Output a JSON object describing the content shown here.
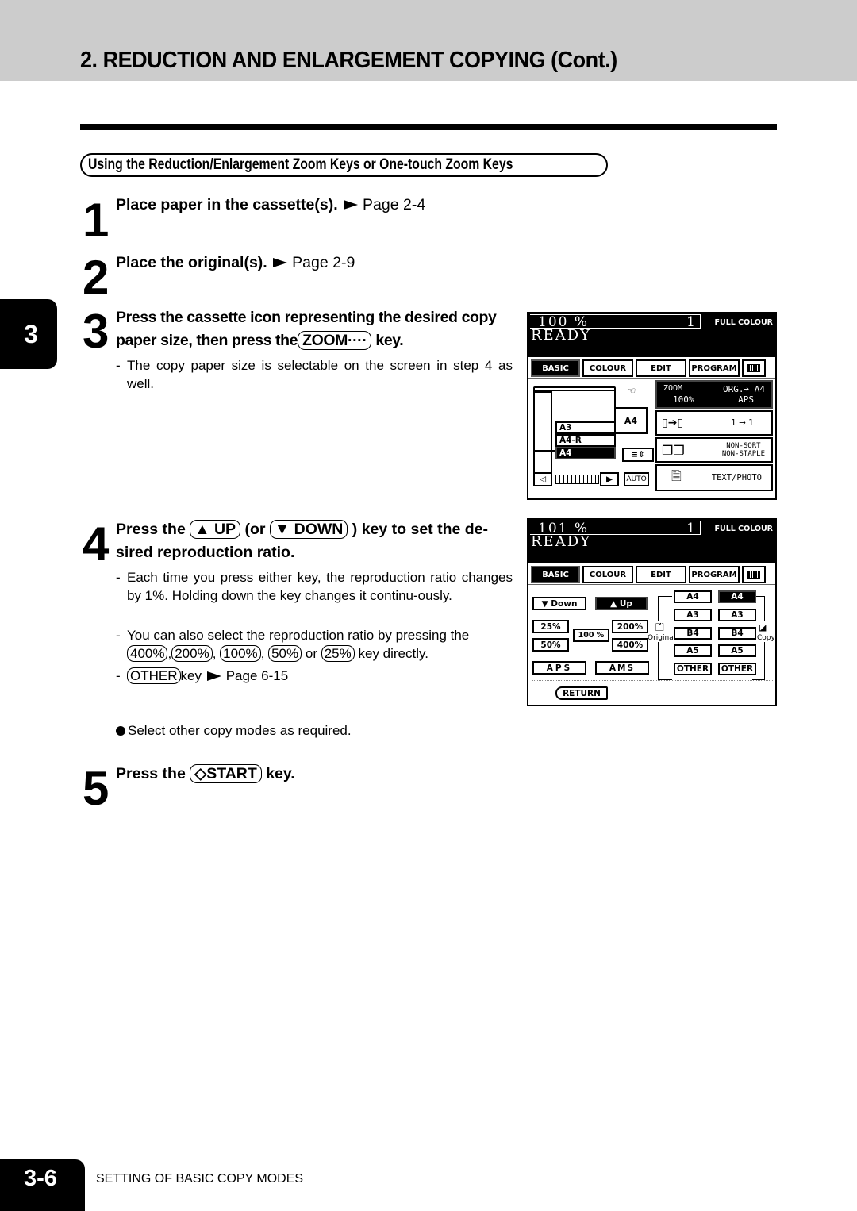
{
  "header": {
    "title": "2. REDUCTION AND ENLARGEMENT COPYING (Cont.)",
    "chapter_tab": "3"
  },
  "subheading": "Using the Reduction/Enlargement Zoom Keys or One-touch Zoom Keys",
  "steps": [
    {
      "number": "1",
      "title": "Place paper in the cassette(s).",
      "ref": "Page 2-4"
    },
    {
      "number": "2",
      "title": "Place the original(s).",
      "ref": "Page 2-9"
    },
    {
      "number": "3",
      "title_line1": "Press the cassette icon representing the desired copy",
      "title_line2_pre": "paper size, then press the",
      "key": "ZOOM····",
      "title_line2_post": "key.",
      "notes": [
        "The copy paper size is selectable on the screen in step 4 as well."
      ]
    },
    {
      "number": "4",
      "title_pre": "Press the",
      "key_up": "▲ UP",
      "title_mid": "(or",
      "key_down": "▼ DOWN",
      "title_post": ") key to set the de-",
      "title_line2": "sired reproduction ratio.",
      "note1": "Each time you press either key, the reproduction ratio changes by 1%. Holding down the key changes it continu-ously.",
      "note2_pre": "You can also select the reproduction ratio by pressing the",
      "ratio_keys": [
        "400%",
        "200%",
        "100%",
        "50%",
        "25%"
      ],
      "note2_or": "or",
      "note2_post": "key directly.",
      "other_key": "OTHER",
      "other_text": "key",
      "other_ref": "Page 6-15"
    },
    {
      "number": "5",
      "title_pre": "Press the",
      "key": "◇START",
      "title_post": "key."
    }
  ],
  "bullet_note": "Select other copy modes as required.",
  "footer": {
    "page_number": "3-6",
    "section": "SETTING OF BASIC COPY MODES"
  },
  "screen1": {
    "ratio": "100  %",
    "copies": "1",
    "colour_mode": "FULL COLOUR",
    "status": "READY",
    "tabs": [
      "BASIC",
      "COLOUR",
      "EDIT",
      "PROGRAM"
    ],
    "active_tab": "BASIC",
    "cassettes": [
      "A4",
      "A3",
      "A4-R",
      "A4"
    ],
    "zoom_label": "ZOOM",
    "zoom_value": "100%",
    "org_label": "ORG.➔ A4",
    "aps_label": "APS",
    "duplex_label": "1 → 1",
    "sort_label1": "NON-SORT",
    "sort_label2": "NON-STAPLE",
    "auto_label": "AUTO",
    "image_mode": "TEXT/PHOTO"
  },
  "screen2": {
    "ratio": "101  %",
    "copies": "1",
    "colour_mode": "FULL COLOUR",
    "status": "READY",
    "tabs": [
      "BASIC",
      "COLOUR",
      "EDIT",
      "PROGRAM"
    ],
    "active_tab": "BASIC",
    "down_label": "▼ Down",
    "up_label": "▲  Up",
    "preset_keys": {
      "p25": "25%",
      "p50": "50%",
      "p100": "100 %",
      "p200": "200%",
      "p400": "400%"
    },
    "aps_label": "APS",
    "ams_label": "AMS",
    "original_label": "Original",
    "copy_label": "Copy",
    "original_sizes": [
      "A4",
      "A3",
      "B4",
      "A5",
      "OTHER"
    ],
    "copy_sizes": [
      "A4",
      "A3",
      "B4",
      "A5",
      "OTHER"
    ],
    "selected_copy_size": "A4",
    "return_label": "RETURN"
  }
}
